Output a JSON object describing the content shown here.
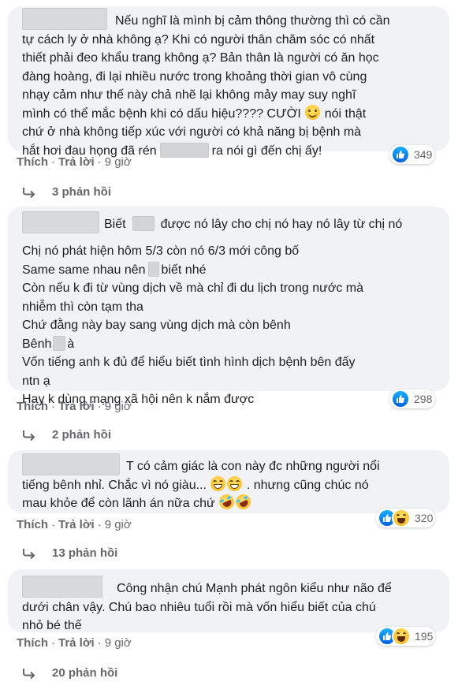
{
  "comments": [
    {
      "lines": [
        "Nếu nghĩ là mình bị cảm thông thường thì có cần",
        "tự cách ly ở nhà không ạ? Khi có người thân chăm sóc có nhất",
        "thiết phải đeo khẩu trang không ạ? Bản thân là người có ăn học",
        "đàng hoàng, đi lại nhiều nước trong khoảng thời gian vô cùng",
        "nhạy cảm như thế này chả nhẽ lại không mảy may suy nghĩ",
        "mình có thể mắc bệnh khi có dấu hiệu???? CƯỜI",
        "nói thật",
        "chứ ở nhà không tiếp xúc với người có khả năng bị bệnh mà",
        "hắt hơi đau họng đã rén",
        "ra nói gì đến chị ấy!"
      ],
      "emoji": "smile-emoji",
      "actions": {
        "like": "Thích",
        "reply": "Trả lời",
        "time": "9 giờ"
      },
      "reaction_count": "349",
      "reaction_types": [
        "like"
      ],
      "replies_label": "3 phản hồi"
    },
    {
      "lines": [
        "Biết",
        "được nó lây cho chị nó hay nó lây từ chị nó",
        "Chị nó phát hiện hôm 5/3 còn nó 6/3 mới công bố",
        "Same same nhau nên",
        "biết nhé",
        "Còn nếu k đi từ vùng dịch về mà chỉ đi du lịch trong nước mà",
        "nhiễm thì còn tạm tha",
        "Chứ đằng này bay sang vùng dịch mà còn bênh",
        "Bênh",
        "à",
        "Vốn tiếng anh k đủ để hiểu biết tình hình dịch bệnh bên đấy",
        "ntn ạ",
        "Hay k dùng mạng xã hội nên k nắm được"
      ],
      "actions": {
        "like": "Thích",
        "reply": "Trả lời",
        "time": "9 giờ"
      },
      "reaction_count": "298",
      "reaction_types": [
        "like"
      ],
      "replies_label": "2 phản hồi"
    },
    {
      "lines": [
        "T có cảm giác là con này đc những người nổi",
        "tiếng bênh nhỉ. Chắc vì nó giàu...",
        ". nhưng cũng chúc nó",
        "mau khỏe để còn lãnh án nữa chứ"
      ],
      "emojis": [
        "grin-emoji",
        "grin-emoji",
        "rofl-emoji",
        "rofl-emoji"
      ],
      "actions": {
        "like": "Thích",
        "reply": "Trả lời",
        "time": "9 giờ"
      },
      "reaction_count": "320",
      "reaction_types": [
        "like",
        "haha"
      ],
      "replies_label": "13 phản hồi"
    },
    {
      "lines": [
        "Công nhận chú Mạnh phát ngôn kiểu như não để",
        "dưới chân vậy. Chú bao nhiêu tuổi rồi mà vốn hiểu biết của chú",
        "nhỏ bé thế"
      ],
      "actions": {
        "like": "Thích",
        "reply": "Trả lời",
        "time": "9 giờ"
      },
      "reaction_count": "195",
      "reaction_types": [
        "like",
        "haha"
      ],
      "replies_label": "20 phản hồi"
    }
  ],
  "colors": {
    "bubble": "#f0f2f5",
    "text": "#1c1e21",
    "secondary": "#65676b",
    "like_blue": "#1877f2"
  }
}
